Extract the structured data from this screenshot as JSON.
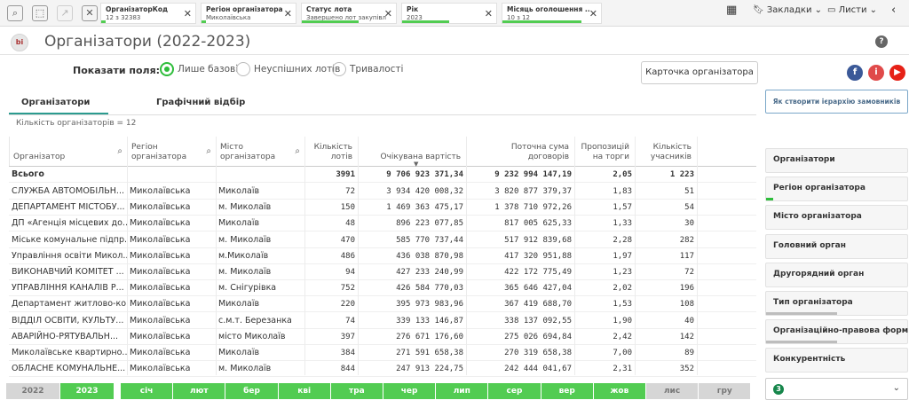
{
  "topbar": {
    "chips": [
      {
        "title": "ОрганізаторКод",
        "sub": "12 з 32383",
        "fill": 0.05
      },
      {
        "title": "Регіон організатора",
        "sub": "Миколаївська",
        "fill": 0.05
      },
      {
        "title": "Статус лота",
        "sub": "Завершено лот закупівлі",
        "fill": 0.6
      },
      {
        "title": "Рік",
        "sub": "2023",
        "fill": 0.5
      },
      {
        "title": "Місяць оголошення ...",
        "sub": "10 з 12",
        "fill": 0.8
      }
    ],
    "bookmarks_label": "Закладки",
    "sheets_label": "Листи"
  },
  "header": {
    "logo_text": "bi",
    "title": "Організатори (2022-2023)",
    "help_text": "?"
  },
  "fields": {
    "label": "Показати поля:",
    "options": [
      "Лише базові",
      "Неуспішних лотів",
      "Тривалості"
    ],
    "selected": 0
  },
  "org_card_button": "Карточка організатора",
  "social": [
    {
      "glyph": "f",
      "color": "#3b5998"
    },
    {
      "glyph": "i",
      "color": "#e04a4a"
    },
    {
      "glyph": "▶",
      "color": "#e62117"
    }
  ],
  "hierarchy_button": "Як створити ієрархію замовників",
  "tabs": [
    "Організатори",
    "Графічний відбір"
  ],
  "active_tab": 0,
  "org_count": "Кількість організаторів = 12",
  "table": {
    "headers": [
      "Організатор",
      "Регіон організатора",
      "Місто організатора",
      "Кількість лотів",
      "Очікувана вартість",
      "Поточна сума договорів",
      "Пропозицій на торги",
      "Кількість учасників"
    ],
    "total": [
      "Всього",
      "",
      "",
      "3991",
      "9 706 923 371,34",
      "9 232 994 147,19",
      "2,05",
      "1 223"
    ],
    "rows": [
      [
        "СЛУЖБА АВТОМОБІЛЬН...",
        "Миколаївська",
        "Миколаїв",
        "72",
        "3 934 420 008,32",
        "3 820 877 379,37",
        "1,83",
        "51"
      ],
      [
        "ДЕПАРТАМЕНТ МІСТОБУ...",
        "Миколаївська",
        "м. Миколаїв",
        "150",
        "1 469 363 475,17",
        "1 378 710 972,26",
        "1,57",
        "54"
      ],
      [
        "ДП «Агенція місцевих до...",
        "Миколаївська",
        "Миколаїв",
        "48",
        "896 223 077,85",
        "817 005 625,33",
        "1,33",
        "30"
      ],
      [
        "Міське комунальне підпр...",
        "Миколаївська",
        "м. Миколаїв",
        "470",
        "585 770 737,44",
        "517 912 839,68",
        "2,28",
        "282"
      ],
      [
        "Управління освіти Микол...",
        "Миколаївська",
        "м.Миколаїв",
        "486",
        "436 038 870,98",
        "417 320 951,88",
        "1,97",
        "117"
      ],
      [
        "ВИКОНАВЧИЙ КОМІТЕТ ...",
        "Миколаївська",
        "м. Миколаїв",
        "94",
        "427 233 240,99",
        "422 172 775,49",
        "1,23",
        "72"
      ],
      [
        "УПРАВЛІННЯ КАНАЛІВ Р...",
        "Миколаївська",
        "м. Снігурівка",
        "752",
        "426 584 770,03",
        "365 646 427,04",
        "2,02",
        "196"
      ],
      [
        "Департамент житлово-ко...",
        "Миколаївська",
        "Миколаїв",
        "220",
        "395 973 983,96",
        "367 419 688,70",
        "1,53",
        "108"
      ],
      [
        "ВІДДІЛ ОСВІТИ, КУЛЬТУ...",
        "Миколаївська",
        "с.м.т. Березанка",
        "74",
        "339 133 146,87",
        "338 137 092,55",
        "1,90",
        "40"
      ],
      [
        "АВАРІЙНО-РЯТУВАЛЬН...",
        "Миколаївська",
        "місто Миколаїв",
        "397",
        "276 671 176,60",
        "275 026 694,84",
        "2,42",
        "142"
      ],
      [
        "Миколаївське квартирно...",
        "Миколаївська",
        "Миколаїв",
        "384",
        "271 591 658,38",
        "270 319 658,38",
        "7,00",
        "89"
      ],
      [
        "ОБЛАСНЕ КОМУНАЛЬНЕ...",
        "Миколаївська",
        "м. Миколаїв",
        "844",
        "247 913 224,75",
        "242 444 041,67",
        "2,31",
        "352"
      ]
    ]
  },
  "filters": [
    {
      "label": "Організатори",
      "fill": 0.0,
      "green": false
    },
    {
      "label": "Регіон організатора",
      "fill": 0.05,
      "green": true
    },
    {
      "label": "Місто організатора",
      "fill": 0.0,
      "green": false
    },
    {
      "label": "Головний орган",
      "fill": 0.0,
      "green": false
    },
    {
      "label": "Другорядний орган",
      "fill": 0.0,
      "green": false
    },
    {
      "label": "Тип організатора",
      "fill": 0.5,
      "green": false
    },
    {
      "label": "Організаційно-правова форм...",
      "fill": 0.5,
      "green": false
    },
    {
      "label": "Конкурентність",
      "fill": 0.0,
      "green": false
    }
  ],
  "filter_dropdown_badge": "3",
  "timeline": {
    "years": [
      {
        "label": "2022",
        "on": false
      },
      {
        "label": "2023",
        "on": true
      }
    ],
    "months": [
      {
        "label": "січ",
        "on": true
      },
      {
        "label": "лют",
        "on": true
      },
      {
        "label": "бер",
        "on": true
      },
      {
        "label": "кві",
        "on": true
      },
      {
        "label": "тра",
        "on": true
      },
      {
        "label": "чер",
        "on": true
      },
      {
        "label": "лип",
        "on": true
      },
      {
        "label": "сер",
        "on": true
      },
      {
        "label": "вер",
        "on": true
      },
      {
        "label": "жов",
        "on": true
      },
      {
        "label": "лис",
        "on": false
      },
      {
        "label": "гру",
        "on": false
      }
    ]
  }
}
